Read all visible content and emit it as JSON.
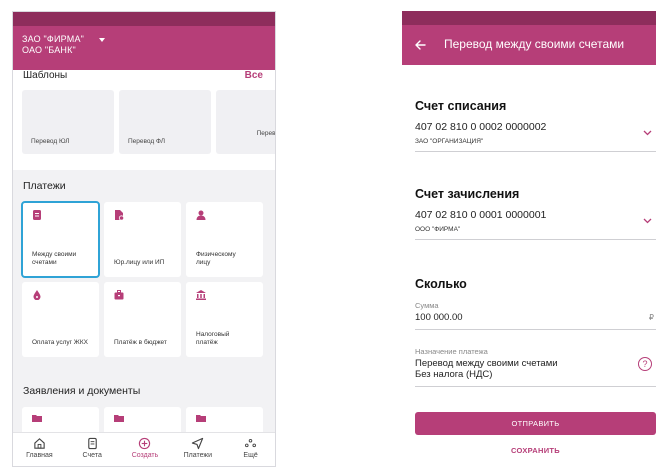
{
  "colors": {
    "brand": "#b63e78",
    "brand_dark": "#8e2d5c",
    "highlight": "#2fa3d6"
  },
  "left": {
    "header": {
      "line1": "ЗАО \"ФИРМА\"",
      "line2": "ОАО \"БАНК\""
    },
    "templates": {
      "title": "Шаблоны",
      "all_label": "Все",
      "cards": [
        {
          "label": "Перевод ЮЛ"
        },
        {
          "label": "Перевод ФЛ"
        },
        {
          "label": "Перевод между счетами"
        }
      ]
    },
    "payments": {
      "title": "Платежи",
      "cards": [
        {
          "label": "Между своими счетами",
          "icon": "document-icon",
          "selected": true
        },
        {
          "label": "Юр.лицу или ИП",
          "icon": "file-person-icon"
        },
        {
          "label": "Физическому лицу",
          "icon": "person-icon"
        },
        {
          "label": "Оплата услуг ЖКХ",
          "icon": "drop-icon"
        },
        {
          "label": "Платёж в бюджет",
          "icon": "briefcase-icon"
        },
        {
          "label": "Налоговый платёж",
          "icon": "bank-icon"
        }
      ]
    },
    "documents": {
      "title": "Заявления и документы"
    },
    "nav": [
      {
        "label": "Главная",
        "icon": "home-icon"
      },
      {
        "label": "Счета",
        "icon": "accounts-icon"
      },
      {
        "label": "Создать",
        "icon": "plus-circle-icon",
        "active": true
      },
      {
        "label": "Платежи",
        "icon": "send-icon"
      },
      {
        "label": "Ещё",
        "icon": "more-icon"
      }
    ]
  },
  "right": {
    "title": "Перевод между своими счетами",
    "debit": {
      "heading": "Счет списания",
      "account": "407 02 810 0 0002 0000002",
      "owner": "ЗАО \"ОРГАНИЗАЦИЯ\""
    },
    "credit": {
      "heading": "Счет зачисления",
      "account": "407 02 810 0 0001 0000001",
      "owner": "ООО \"ФИРМА\""
    },
    "amount": {
      "heading": "Сколько",
      "label": "Сумма",
      "value": "100 000.00",
      "currency": "₽"
    },
    "purpose": {
      "label": "Назначение платежа",
      "line1": "Перевод между своими счетами",
      "line2": "Без налога (НДС)",
      "help": "?"
    },
    "send_label": "ОТПРАВИТЬ",
    "save_label": "СОХРАНИТЬ"
  }
}
